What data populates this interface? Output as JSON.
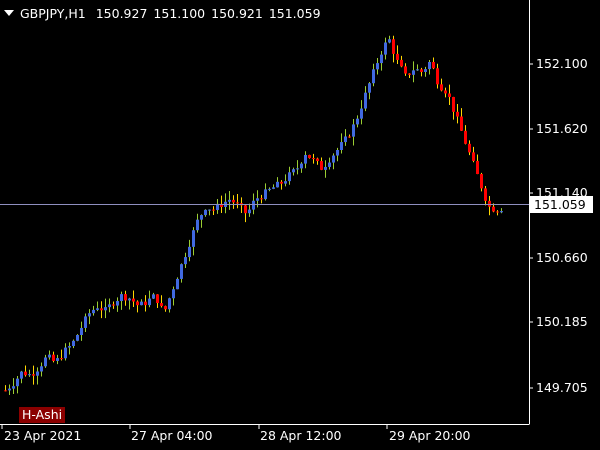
{
  "header": {
    "symbol": "GBPJPY,H1",
    "open": "150.927",
    "high": "151.100",
    "low": "150.921",
    "close": "151.059"
  },
  "price_axis": {
    "ticks": [
      "152.100",
      "151.620",
      "151.140",
      "150.660",
      "150.185",
      "149.705"
    ],
    "current_price": "151.059"
  },
  "time_axis": {
    "ticks": [
      "23 Apr 2021",
      "27 Apr 04:00",
      "28 Apr 12:00",
      "29 Apr 20:00"
    ]
  },
  "indicator": {
    "label": "H-Ashi"
  },
  "colors": {
    "background": "#000000",
    "bull": "#4169e1",
    "bear": "#ff0000",
    "wick_up": "#9acd32",
    "wick_down": "#ffd700",
    "axis": "#ffffff",
    "price_line": "#8f8fbf",
    "label_bg": "#8b0000"
  },
  "chart_data": {
    "type": "candlestick",
    "instrument": "GBPJPY",
    "timeframe": "H1",
    "y_range": [
      149.58,
      152.35
    ],
    "current_price": 151.059,
    "close_path": [
      149.8,
      149.85,
      149.92,
      149.9,
      149.95,
      150.02,
      149.98,
      150.05,
      150.1,
      150.2,
      150.3,
      150.35,
      150.32,
      150.38,
      150.42,
      150.4,
      150.35,
      150.38,
      150.42,
      150.3,
      150.45,
      150.6,
      150.75,
      150.9,
      151.0,
      150.98,
      151.02,
      151.05,
      151.0,
      150.95,
      151.05,
      151.08,
      151.12,
      151.15,
      151.2,
      151.25,
      151.35,
      151.3,
      151.25,
      151.32,
      151.38,
      151.45,
      151.55,
      151.7,
      151.85,
      152.0,
      152.1,
      151.95,
      151.85,
      151.9,
      151.88,
      151.95,
      151.8,
      151.75,
      151.6,
      151.45,
      151.3,
      151.15,
      151.0,
      150.98,
      151.0
    ]
  }
}
